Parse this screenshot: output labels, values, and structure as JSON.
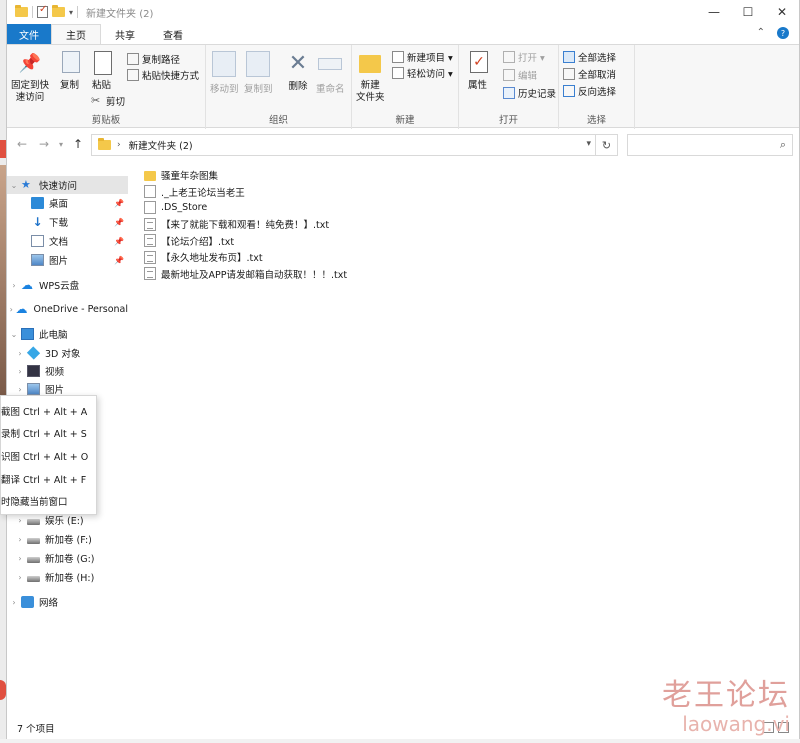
{
  "titlebar": {
    "title": "新建文件夹 (2)",
    "minimize": "—",
    "maximize": "☐",
    "close": "✕"
  },
  "tabs": {
    "file": "文件",
    "home": "主页",
    "share": "共享",
    "view": "查看",
    "collapse": "⌃",
    "help": "?"
  },
  "ribbon": {
    "clipboard": {
      "label": "剪贴板",
      "pin_quick": "固定到快速访问",
      "pin_quick_l1": "固定到快",
      "pin_quick_l2": "速访问",
      "copy": "复制",
      "paste": "粘贴",
      "copy_path": "复制路径",
      "paste_shortcut": "粘贴快捷方式",
      "cut": "剪切"
    },
    "organize": {
      "label": "组织",
      "move_to": "移动到",
      "copy_to": "复制到",
      "delete": "删除",
      "rename": "重命名"
    },
    "new": {
      "label": "新建",
      "new_folder_l1": "新建",
      "new_folder_l2": "文件夹",
      "new_item": "新建项目 ▾",
      "easy_access": "轻松访问 ▾"
    },
    "open": {
      "label": "打开",
      "properties": "属性",
      "open": "打开 ▾",
      "edit": "编辑",
      "history": "历史记录"
    },
    "select": {
      "label": "选择",
      "select_all": "全部选择",
      "select_none": "全部取消",
      "invert": "反向选择"
    }
  },
  "address": {
    "path": "新建文件夹 (2)",
    "chevron": "›",
    "search_placeholder": ""
  },
  "nav": {
    "quick_access": "快速访问",
    "desktop": "桌面",
    "downloads": "下载",
    "documents": "文档",
    "pictures": "图片",
    "wps": "WPS云盘",
    "onedrive": "OneDrive - Personal",
    "this_pc": "此电脑",
    "objects3d": "3D 对象",
    "videos": "视频",
    "pictures2": "图片",
    "drive_e": "娱乐 (E:)",
    "drive_f": "新加卷 (F:)",
    "drive_g": "新加卷 (G:)",
    "drive_h": "新加卷 (H:)",
    "network": "网络"
  },
  "files": [
    {
      "name": "骚童年杂图集",
      "type": "folder"
    },
    {
      "name": "._上老王论坛当老王",
      "type": "file"
    },
    {
      "name": ".DS_Store",
      "type": "file"
    },
    {
      "name": "【来了就能下载和观看！纯免费！】.txt",
      "type": "txt"
    },
    {
      "name": "【论坛介绍】.txt",
      "type": "txt"
    },
    {
      "name": "【永久地址发布页】.txt",
      "type": "txt"
    },
    {
      "name": "最新地址及APP请发邮箱自动获取！！！.txt",
      "type": "txt"
    }
  ],
  "popup": {
    "item1": "截图 Ctrl + Alt + A",
    "item2": "录制 Ctrl + Alt + S",
    "item3": "识图 Ctrl + Alt + O",
    "item4": "翻译 Ctrl + Alt + F",
    "item5": "时隐藏当前窗口"
  },
  "status": {
    "count": "7 个项目"
  },
  "watermark": {
    "cn": "老王论坛",
    "en": "laowang.vi"
  },
  "colors": {
    "accent": "#1979ca",
    "folder": "#f4c84a",
    "watermark": "#e0a09b"
  }
}
